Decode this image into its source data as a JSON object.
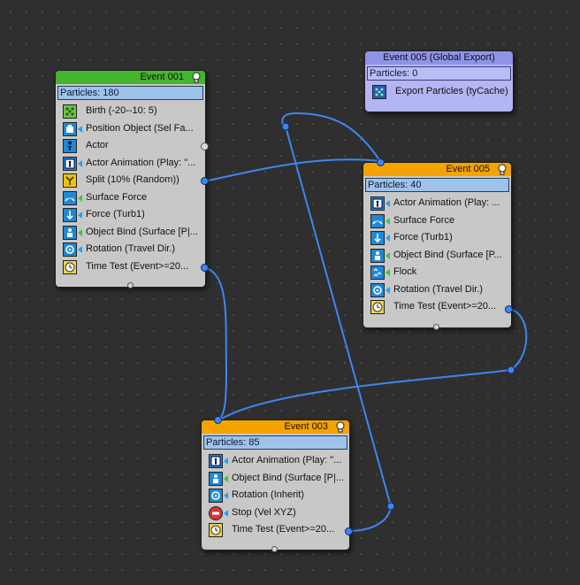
{
  "colors": {
    "canvas_bg": "#2f2f2f",
    "node_body": "#c8c8c8",
    "header_green": "#43b62e",
    "header_orange": "#f5a300",
    "header_global": "#8f93e8",
    "particles_bar": "#9ec3ea",
    "wire_blue": "#3f86f0"
  },
  "nodes": {
    "event001": {
      "title": "Event  001",
      "particles": "Particles: 180",
      "operators": [
        {
          "label": "Birth (-20--10: 5)",
          "icon": "birth-icon"
        },
        {
          "label": "Position Object (Sel Fa...",
          "icon": "position-object-icon"
        },
        {
          "label": "Actor",
          "icon": "actor-icon"
        },
        {
          "label": "Actor Animation (Play: \"...",
          "icon": "actor-animation-icon"
        },
        {
          "label": "Split (10% (Random))",
          "icon": "split-icon"
        },
        {
          "label": "Surface Force",
          "icon": "surface-force-icon"
        },
        {
          "label": "Force (Turb1)",
          "icon": "force-icon"
        },
        {
          "label": "Object Bind (Surface [P|...",
          "icon": "object-bind-icon"
        },
        {
          "label": "Rotation (Travel Dir.)",
          "icon": "rotation-icon"
        },
        {
          "label": "Time Test (Event>=20...",
          "icon": "time-test-icon"
        }
      ]
    },
    "event005global": {
      "title": "Event  005 (Global Export)",
      "particles": "Particles: 0",
      "operators": [
        {
          "label": "Export Particles (tyCache)",
          "icon": "export-particles-icon"
        }
      ]
    },
    "event005": {
      "title": "Event  005",
      "particles": "Particles: 40",
      "operators": [
        {
          "label": "Actor Animation (Play: ...",
          "icon": "actor-animation-icon"
        },
        {
          "label": "Surface Force",
          "icon": "surface-force-icon"
        },
        {
          "label": "Force (Turb1)",
          "icon": "force-icon"
        },
        {
          "label": "Object Bind (Surface [P...",
          "icon": "object-bind-icon"
        },
        {
          "label": "Flock",
          "icon": "flock-icon"
        },
        {
          "label": "Rotation (Travel Dir.)",
          "icon": "rotation-icon"
        },
        {
          "label": "Time Test (Event>=20...",
          "icon": "time-test-icon"
        }
      ]
    },
    "event003": {
      "title": "Event  003",
      "particles": "Particles: 85",
      "operators": [
        {
          "label": "Actor Animation (Play: \"...",
          "icon": "actor-animation-icon"
        },
        {
          "label": "Object Bind (Surface [P|...",
          "icon": "object-bind-icon"
        },
        {
          "label": "Rotation (Inherit)",
          "icon": "rotation-icon"
        },
        {
          "label": "Stop (Vel XYZ)",
          "icon": "stop-icon"
        },
        {
          "label": "Time Test (Event>=20...",
          "icon": "time-test-icon"
        }
      ]
    }
  }
}
